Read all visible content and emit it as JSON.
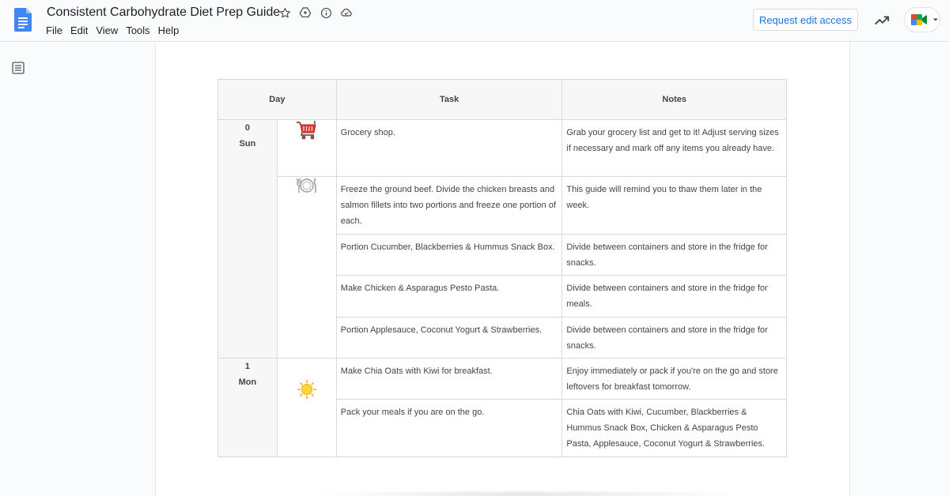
{
  "app": {
    "doc_title": "Consistent Carbohydrate Diet Prep Guide",
    "menu": [
      "File",
      "Edit",
      "View",
      "Tools",
      "Help"
    ],
    "request_edit_label": "Request edit access",
    "title_icons": [
      "star-icon",
      "move-to-drive-icon",
      "details-icon",
      "cloud-status-icon"
    ],
    "accent_color": "#1a73e8"
  },
  "table": {
    "headers": {
      "day": "Day",
      "task": "Task",
      "notes": "Notes"
    },
    "days": [
      {
        "num": "0",
        "name": "Sun"
      },
      {
        "num": "1",
        "name": "Mon"
      }
    ],
    "rows": [
      {
        "task": "Grocery shop.",
        "note": "Grab your grocery list and get to it! Adjust serving sizes if necessary and mark off any items you already have."
      },
      {
        "task": "Freeze the ground beef. Divide the chicken breasts and salmon fillets into two portions and freeze one portion of each.",
        "note": "This guide will remind you to thaw them later in the week."
      },
      {
        "task": "Portion Cucumber, Blackberries & Hummus Snack Box.",
        "note": "Divide between containers and store in the fridge for snacks."
      },
      {
        "task": "Make Chicken & Asparagus Pesto Pasta.",
        "note": "Divide between containers and store in the fridge for meals."
      },
      {
        "task": "Portion Applesauce, Coconut Yogurt & Strawberries.",
        "note": "Divide between containers and store in the fridge for snacks."
      },
      {
        "task": "Make Chia Oats with Kiwi for breakfast.",
        "note": "Enjoy immediately or pack if you're on the go and store leftovers for breakfast tomorrow."
      },
      {
        "task": "Pack your meals if you are on the go.",
        "note": "Chia Oats with Kiwi, Cucumber, Blackberries & Hummus Snack Box, Chicken & Asparagus Pesto Pasta, Applesauce, Coconut Yogurt & Strawberries."
      }
    ],
    "row_icons": [
      "shopping-cart-icon",
      "plate-cutlery-icon",
      "sun-icon"
    ]
  }
}
